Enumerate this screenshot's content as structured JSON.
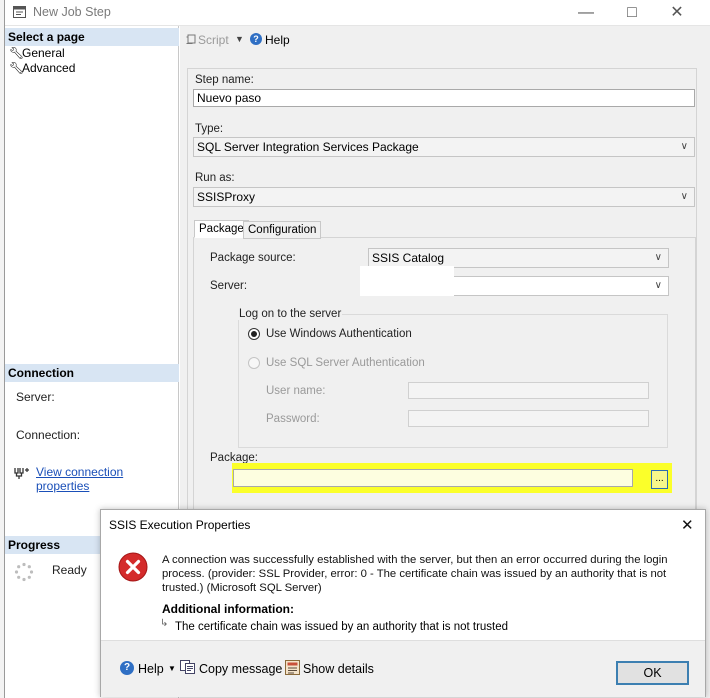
{
  "window": {
    "title": "New Job Step"
  },
  "left_pane": {
    "select_header": "Select a page",
    "pages": [
      {
        "label": "General"
      },
      {
        "label": "Advanced"
      }
    ],
    "connection_header": "Connection",
    "server_label": "Server:",
    "connection_label": "Connection:",
    "view_connection_link": "View connection properties",
    "progress_header": "Progress",
    "progress_status": "Ready"
  },
  "toolbar": {
    "script_label": "Script",
    "help_label": "Help"
  },
  "form": {
    "step_name_label": "Step name:",
    "step_name_value": "Nuevo paso",
    "type_label": "Type:",
    "type_value": "SQL Server Integration Services Package",
    "run_as_label": "Run as:",
    "run_as_value": "SSISProxy",
    "tabs": [
      {
        "label": "Package"
      },
      {
        "label": "Configuration"
      }
    ],
    "package_source_label": "Package source:",
    "package_source_value": "SSIS Catalog",
    "server_label": "Server:",
    "server_value": "",
    "logon_group_label": "Log on to the server",
    "windows_auth_label": "Use Windows Authentication",
    "sql_auth_label": "Use SQL Server Authentication",
    "user_name_label": "User name:",
    "password_label": "Password:",
    "package_label": "Package:",
    "package_value": "",
    "browse_label": "..."
  },
  "dialog": {
    "title": "SSIS Execution Properties",
    "message_lines": [
      "A connection was successfully established with the server, but then an error occurred during the login",
      "process. (provider: SSL Provider, error: 0 - The certificate chain was issued by an authority that is not",
      "trusted.) (Microsoft SQL Server)"
    ],
    "additional_info_header": "Additional information:",
    "additional_info_text": "The certificate chain was issued by an authority that is not trusted",
    "footer": {
      "help_label": "Help",
      "copy_label": "Copy message",
      "details_label": "Show details",
      "ok_label": "OK"
    }
  },
  "colors": {
    "section_header_bg": "#d8e5f3",
    "highlight": "#fbff2a",
    "error_red": "#d42b2b",
    "link": "#1a4fb8"
  },
  "icons": [
    "window-app-icon",
    "minimize-icon",
    "maximize-icon",
    "close-icon",
    "wrench-icon",
    "script-icon",
    "help-icon",
    "chevron-down-icon",
    "connection-plug-icon",
    "progress-spinner-icon",
    "error-icon",
    "copy-icon",
    "details-icon",
    "sub-arrow-icon"
  ]
}
